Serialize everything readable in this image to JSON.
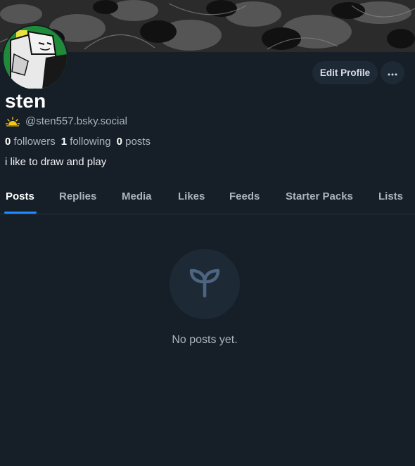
{
  "profile": {
    "display_name": "sten",
    "handle": "@sten557.bsky.social",
    "status_icon": "sunrise-icon",
    "bio": "i like to draw and play"
  },
  "stats": {
    "followers_count": "0",
    "followers_label": "followers",
    "following_count": "1",
    "following_label": "following",
    "posts_count": "0",
    "posts_label": "posts"
  },
  "actions": {
    "edit_profile_label": "Edit Profile",
    "more_icon": "ellipsis-icon"
  },
  "tabs": [
    {
      "label": "Posts",
      "active": true
    },
    {
      "label": "Replies",
      "active": false
    },
    {
      "label": "Media",
      "active": false
    },
    {
      "label": "Likes",
      "active": false
    },
    {
      "label": "Feeds",
      "active": false
    },
    {
      "label": "Starter Packs",
      "active": false
    },
    {
      "label": "Lists",
      "active": false
    }
  ],
  "empty_state": {
    "icon": "seedling-icon",
    "message": "No posts yet."
  },
  "colors": {
    "background": "#161e27",
    "accent": "#208bfe",
    "button_bg": "#1e2936",
    "muted_text": "#aab4bf"
  }
}
